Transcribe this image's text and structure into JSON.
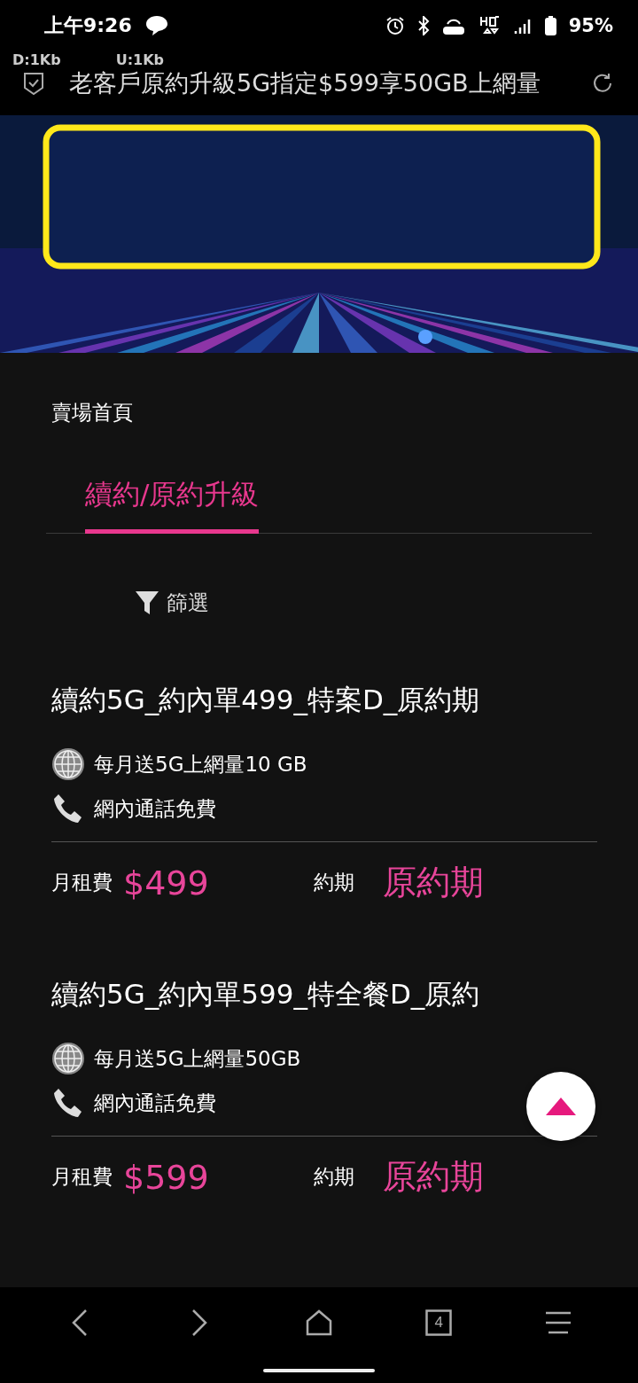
{
  "status_bar": {
    "time": "上午9:26",
    "battery": "95%"
  },
  "net_speed": {
    "down": "D:1Kb",
    "up": "U:1Kb"
  },
  "address_bar": {
    "title": "老客戶原約升級5G指定$599享50GB上網量"
  },
  "breadcrumb": "賣場首頁",
  "tabs": [
    {
      "label": "續約/原約升級",
      "selected": true
    }
  ],
  "filter": {
    "label": "篩選"
  },
  "plans": [
    {
      "name": "續約5G_約內單499_特案D_原約期",
      "features": [
        {
          "kind": "data",
          "text": "每月送5G上網量10 GB"
        },
        {
          "kind": "call",
          "text": "網內通話免費"
        }
      ],
      "fee_label": "月租費",
      "fee": "$499",
      "term_label": "約期",
      "term": "原約期"
    },
    {
      "name": "續約5G_約內單599_特全餐D_原約",
      "features": [
        {
          "kind": "data",
          "text": "每月送5G上網量50GB"
        },
        {
          "kind": "call",
          "text": "網內通話免費"
        }
      ],
      "fee_label": "月租費",
      "fee": "$599",
      "term_label": "約期",
      "term": "原約期"
    }
  ],
  "nav": {
    "tab_count": "4"
  }
}
